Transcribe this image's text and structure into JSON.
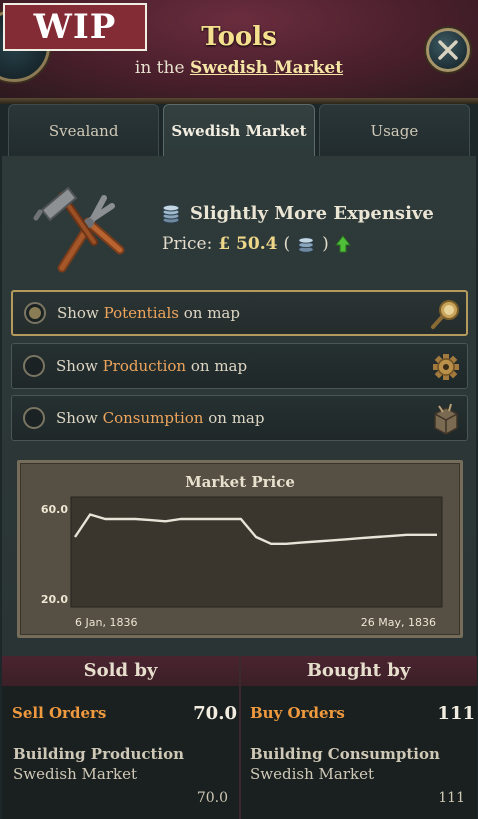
{
  "wip_label": "WIP",
  "header": {
    "title": "Tools",
    "subtitle_prefix": "in the",
    "market_link": "Swedish Market"
  },
  "tabs": [
    {
      "label": "Svealand",
      "active": false
    },
    {
      "label": "Swedish Market",
      "active": true
    },
    {
      "label": "Usage",
      "active": false
    }
  ],
  "goods": {
    "icon": "hammer-pliers-icon",
    "status": "Slightly More Expensive",
    "price_label": "Price:",
    "price_value": "£ 50.4",
    "trend": "up"
  },
  "map_options": [
    {
      "prefix": "Show",
      "highlight": "Potentials",
      "suffix": "on map",
      "selected": true,
      "icon": "magnifier-icon"
    },
    {
      "prefix": "Show",
      "highlight": "Production",
      "suffix": "on map",
      "selected": false,
      "icon": "gear-icon"
    },
    {
      "prefix": "Show",
      "highlight": "Consumption",
      "suffix": "on map",
      "selected": false,
      "icon": "crate-icon"
    }
  ],
  "chart_data": {
    "type": "line",
    "title": "Market Price",
    "xlabel": "",
    "ylabel": "",
    "ytick_labels": [
      "60.0",
      "20.0"
    ],
    "ylim": [
      20,
      60
    ],
    "x_start_label": "6 Jan, 1836",
    "x_end_label": "26 May, 1836",
    "values": [
      48,
      58,
      56,
      56,
      56,
      55.5,
      55,
      56,
      56,
      56,
      56,
      56,
      48,
      45,
      45,
      45.5,
      46,
      46.5,
      47,
      47.5,
      48,
      48.5,
      49,
      49,
      49
    ]
  },
  "trade": {
    "sold_by": {
      "header": "Sold by",
      "orders_label": "Sell Orders",
      "orders_value": "70.0",
      "building_title": "Building Production",
      "building_sub": "Swedish Market",
      "building_value": "70.0"
    },
    "bought_by": {
      "header": "Bought by",
      "orders_label": "Buy Orders",
      "orders_value": "111",
      "building_title": "Building Consumption",
      "building_sub": "Swedish Market",
      "building_value": "111"
    }
  },
  "colors": {
    "accent_gold": "#f4e08e",
    "highlight_orange": "#eea55c",
    "order_label": "#ef9a3e",
    "trend_up": "#4fbf3a"
  }
}
